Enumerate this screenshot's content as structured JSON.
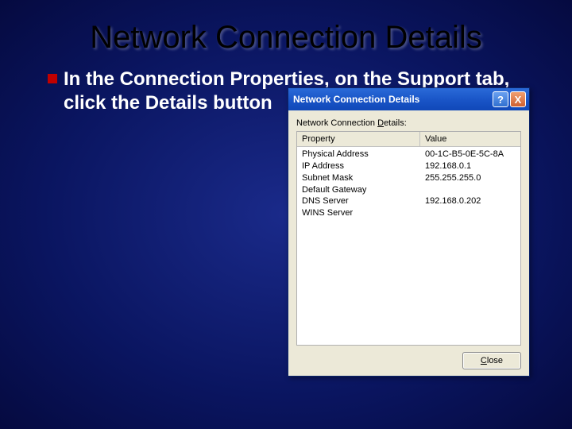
{
  "slide": {
    "title": "Network Connection Details",
    "bullet_text": "In the Connection Properties, on the Support tab, click the Details button"
  },
  "dialog": {
    "title": "Network Connection Details",
    "help_glyph": "?",
    "close_glyph": "X",
    "label_before": "Network Connection ",
    "label_accel": "D",
    "label_after": "etails:",
    "header_property": "Property",
    "header_value": "Value",
    "rows": [
      {
        "prop": "Physical Address",
        "val": "00-1C-B5-0E-5C-8A"
      },
      {
        "prop": "IP Address",
        "val": "192.168.0.1"
      },
      {
        "prop": "Subnet Mask",
        "val": "255.255.255.0"
      },
      {
        "prop": "Default Gateway",
        "val": ""
      },
      {
        "prop": "DNS Server",
        "val": "192.168.0.202"
      },
      {
        "prop": "WINS Server",
        "val": ""
      }
    ],
    "close_accel": "C",
    "close_after": "lose"
  }
}
